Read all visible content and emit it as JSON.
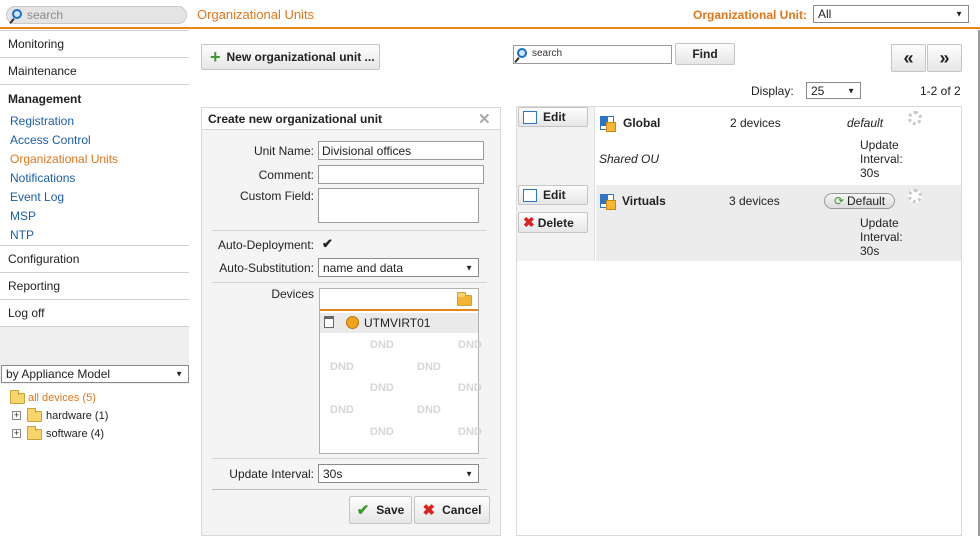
{
  "topbar": {
    "search_placeholder": "search",
    "page_title": "Organizational Units",
    "ou_label": "Organizational Unit:",
    "ou_value": "All"
  },
  "sidebar": {
    "sections": [
      {
        "label": "Monitoring"
      },
      {
        "label": "Maintenance"
      },
      {
        "label": "Management"
      }
    ],
    "management_items": [
      {
        "label": "Registration"
      },
      {
        "label": "Access Control"
      },
      {
        "label": "Organizational Units",
        "active": true
      },
      {
        "label": "Notifications"
      },
      {
        "label": "Event Log"
      },
      {
        "label": "MSP"
      },
      {
        "label": "NTP"
      }
    ],
    "bottom_sections": [
      {
        "label": "Configuration"
      },
      {
        "label": "Reporting"
      },
      {
        "label": "Log off"
      }
    ],
    "filter_select": "by Appliance Model",
    "tree": {
      "root": "all devices (5)",
      "children": [
        {
          "label": "hardware (1)"
        },
        {
          "label": "software (4)"
        }
      ]
    }
  },
  "toolbar": {
    "new_button": "New organizational unit ...",
    "search_placeholder": "search",
    "find_button": "Find",
    "prev_button": "«",
    "next_button": "»",
    "display_label": "Display:",
    "display_value": "25",
    "paging": "1-2 of 2"
  },
  "dialog": {
    "title": "Create new organizational unit",
    "unit_name_label": "Unit Name:",
    "unit_name_value": "Divisional offices",
    "comment_label": "Comment:",
    "comment_value": "",
    "custom_field_label": "Custom Field:",
    "auto_deployment_label": "Auto-Deployment:",
    "auto_deployment_checked": true,
    "auto_substitution_label": "Auto-Substitution:",
    "auto_substitution_value": "name and data",
    "devices_label": "Devices",
    "device_entry": "UTMVIRT01",
    "dnd_text": "DND",
    "update_interval_label": "Update Interval:",
    "update_interval_value": "30s",
    "save_button": "Save",
    "cancel_button": "Cancel"
  },
  "ou_list": [
    {
      "edit_label": "Edit",
      "name": "Global",
      "devices": "2 devices",
      "default_text": "default",
      "description": "Shared OU",
      "interval_label": "Update Interval:",
      "interval_value": "30s"
    },
    {
      "edit_label": "Edit",
      "delete_label": "Delete",
      "name": "Virtuals",
      "devices": "3 devices",
      "default_button": "Default",
      "interval_label": "Update Interval:",
      "interval_value": "30s"
    }
  ],
  "colors": {
    "accent_orange": "#e8851a",
    "link_blue": "#1a5ea8"
  }
}
